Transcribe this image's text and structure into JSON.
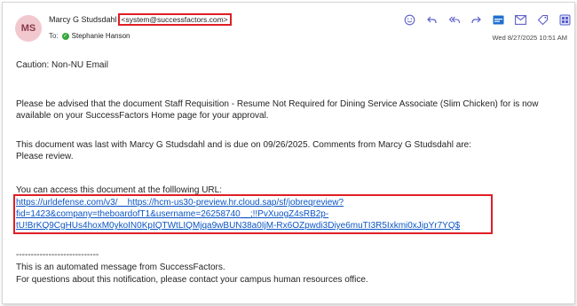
{
  "header": {
    "avatar_initials": "MS",
    "sender_name": "Marcy G Studsdahl",
    "sender_email": "<system@successfactors.com>",
    "to_label": "To:",
    "recipient": "Stephanie Hanson",
    "date": "Wed 8/27/2025 10:51 AM",
    "toolbar_icons": [
      "emoji-icon",
      "reply-icon",
      "reply-all-icon",
      "forward-icon",
      "apps-icon",
      "mail-icon",
      "tag-icon",
      "grid-icon",
      "more-icon"
    ]
  },
  "email": {
    "caution": "Caution: Non-NU Email",
    "para1_line1": "Please be advised that the document Staff Requisition - Resume Not Required for Dining Service Associate (Slim Chicken) for is now",
    "para1_line2": "available on your SuccessFactors Home page for your approval.",
    "para2_line1": "This document was last with Marcy G Studsdahl and is due on 09/26/2025. Comments from Marcy G Studsdahl are:",
    "para2_line2": "Please review.",
    "url_intro": "You can access this document at the folllowing URL:",
    "url_line1": "https://urldefense.com/v3/__https://hcm-us30-preview.hr.cloud.sap/sf/jobreqreview?",
    "url_line2": "fid=1423&company=theboardofT1&username=26258740__;!!PvXuogZ4sRB2p-",
    "url_line3": "tU!BrKQ9CgHUs4hoxM0ykoIN0KpIQTWtLIQMjqa9wBUN38a0IjM-Rx6OZpwdi3Diye6muTI3R5Ixkmi0xJipYr7YQ$",
    "divider": "----------------------------",
    "footer1": "This is an automated message from SuccessFactors.",
    "footer2": "For questions about this notification, please contact your campus human resources office."
  },
  "colors": {
    "highlight": "#e01e25",
    "link": "#0b55c4",
    "accent": "#5b5fc7"
  }
}
